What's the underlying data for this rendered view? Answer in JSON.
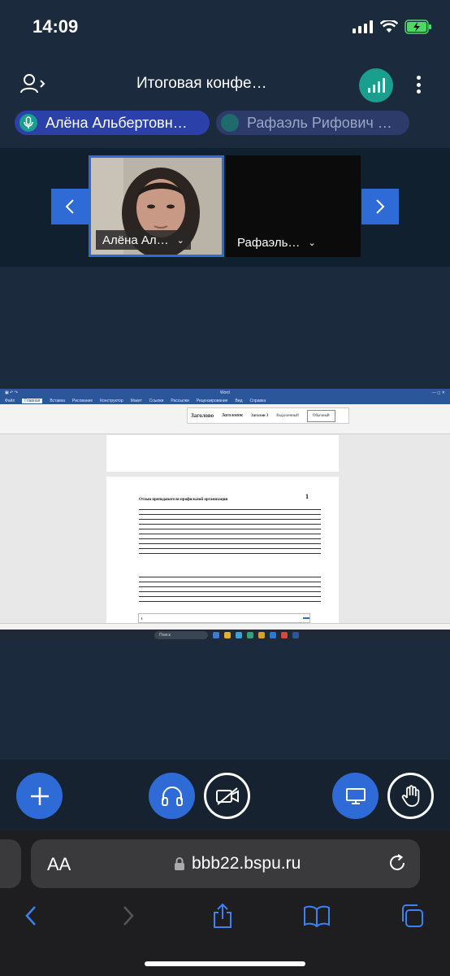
{
  "status_bar": {
    "time": "14:09"
  },
  "header": {
    "meeting_title": "Итоговая конфе…"
  },
  "participants_pills": [
    {
      "name": "Алёна Альбертовн…",
      "mic": "microphone-icon"
    },
    {
      "name": "Рафаэль Рифович …"
    }
  ],
  "video_tiles": [
    {
      "name": "Алёна Ал…"
    },
    {
      "name": "Рафаэль…"
    }
  ],
  "presentation": {
    "doc_page_title": "Отзыв преподавателя профильной организации",
    "page_number": "1",
    "styles": [
      "Заголово",
      "Заголовок",
      "Заголов 3",
      "Выделенный",
      "Обычный"
    ],
    "taskbar_search": "Поиск"
  },
  "browser": {
    "text_size_label": "AA",
    "url": "bbb22.bspu.ru"
  },
  "colors": {
    "accent_blue": "#2e6bd6",
    "teal": "#1a9e8e",
    "background": "#1b2a3d"
  }
}
